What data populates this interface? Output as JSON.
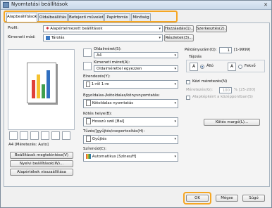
{
  "window": {
    "title": "Nyomtatási beállítások",
    "close": "✕"
  },
  "tabs": [
    {
      "label": "Alapbeállítások"
    },
    {
      "label": "Oldalbeállítás"
    },
    {
      "label": "Befejező művelet"
    },
    {
      "label": "Papírforrás"
    },
    {
      "label": "Minőség"
    }
  ],
  "profile": {
    "label": "Profil:",
    "value": "Alapértelmezett beállítások",
    "add": "Hozzáadás(1)...",
    "edit": "Szerkesztés(2)..."
  },
  "output": {
    "label": "Kimeneti mód:",
    "value": "Tárolás",
    "details": "Részletek(3)..."
  },
  "preview": {
    "caption": "A4 [Méretezés: Auto]"
  },
  "left_buttons": {
    "view_settings": "Beállítások megtekintése(V)",
    "language": "Nyelvi beállítások(W)...",
    "restore": "Alapértékek visszaállítása"
  },
  "page": {
    "size_label": "Oldalméret(S):",
    "size_value": "A4",
    "output_size_label": "Kimeneti méret(A):",
    "output_size_value": "Oldalmérettel egyezzen",
    "copies_label": "Példányszám(Q):",
    "copies_value": "1",
    "copies_range": "[1-9999]",
    "orientation_label": "Tájolás",
    "portrait": "Álló",
    "landscape": "Fekvő"
  },
  "layout": {
    "label": "Elrendezés(Y):",
    "value": "1-ről 1-re",
    "manual_scale": "Kézi méretezés(N)",
    "scale_label": "Méretezés(G):",
    "scale_value": "100",
    "scale_range": "% [25-200]",
    "watermark": "Alapképként a középpontban(S)"
  },
  "duplex": {
    "label": "Egyoldalas-/kétoldalas/könyvnyomtatás:",
    "value": "Kétoldalas nyomtatás"
  },
  "binding": {
    "label": "Kötés helye(B):",
    "value": "Hosszú szél [Bal]",
    "margin_button": "Kötés margó(L)..."
  },
  "collate": {
    "label": "Tűzés/[gyűjtés/csoportosítás(H):",
    "value": "Gyűjtés"
  },
  "color": {
    "label": "Színmód(C):",
    "value": "Automatikus [Színes/ff]"
  },
  "footer": {
    "ok": "OK",
    "cancel": "Mégse",
    "help": "Súgó"
  }
}
